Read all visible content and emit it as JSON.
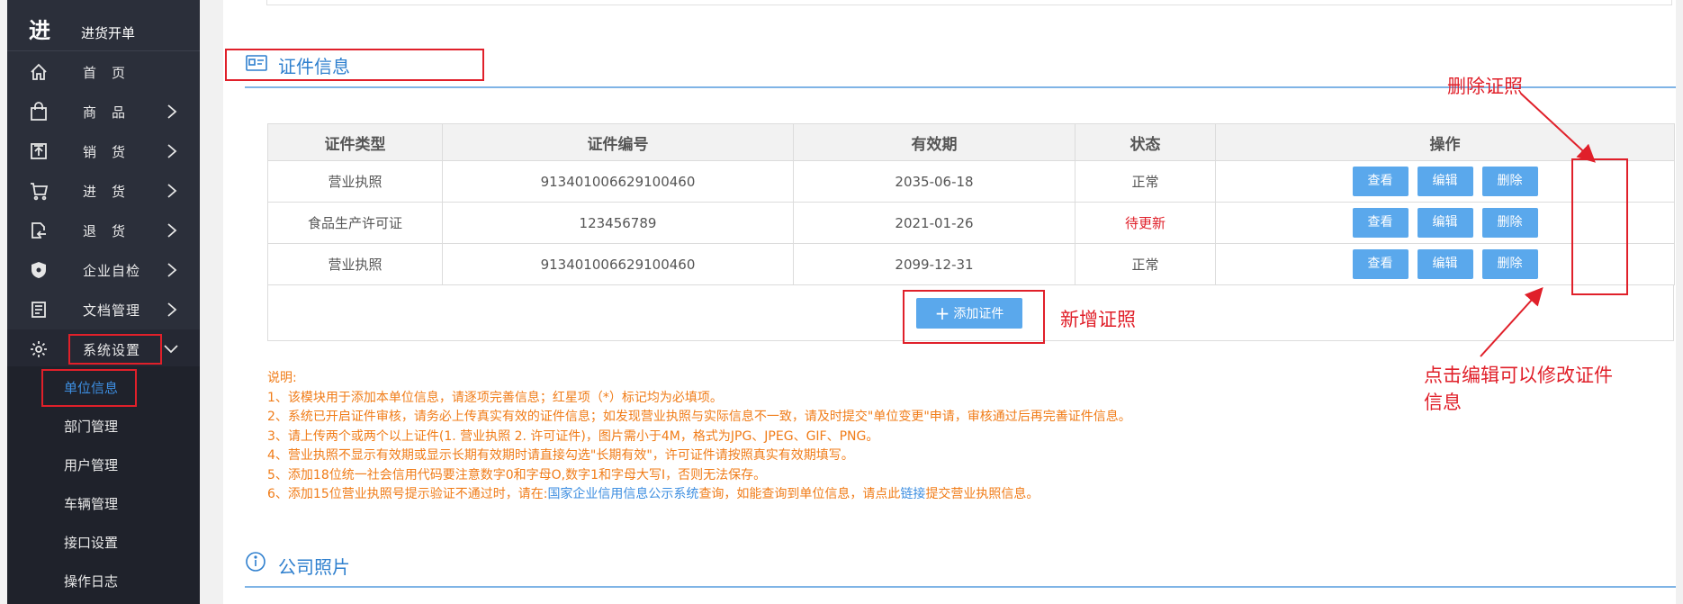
{
  "sidebar": {
    "brand_char": "进",
    "brand_text": "进货开单",
    "items": [
      {
        "label": "首　页",
        "icon": "home-icon"
      },
      {
        "label": "商　品",
        "icon": "bag-icon"
      },
      {
        "label": "销　货",
        "icon": "upload-box-icon"
      },
      {
        "label": "进　货",
        "icon": "cart-icon"
      },
      {
        "label": "退　货",
        "icon": "return-doc-icon"
      },
      {
        "label": "企业自检",
        "icon": "shield-icon"
      },
      {
        "label": "文档管理",
        "icon": "document-icon"
      },
      {
        "label": "系统设置",
        "icon": "gear-icon"
      }
    ],
    "subitems": [
      {
        "label": "单位信息"
      },
      {
        "label": "部门管理"
      },
      {
        "label": "用户管理"
      },
      {
        "label": "车辆管理"
      },
      {
        "label": "接口设置"
      },
      {
        "label": "操作日志"
      }
    ]
  },
  "cert_section": {
    "title": "证件信息",
    "headers": [
      "证件类型",
      "证件编号",
      "有效期",
      "状态",
      "操作"
    ],
    "rows": [
      {
        "type": "营业执照",
        "number": "913401006629100460",
        "expiry": "2035-06-18",
        "status": "正常"
      },
      {
        "type": "食品生产许可证",
        "number": "123456789",
        "expiry": "2021-01-26",
        "status": "待更新"
      },
      {
        "type": "营业执照",
        "number": "913401006629100460",
        "expiry": "2099-12-31",
        "status": "正常"
      }
    ],
    "actions": {
      "view": "查看",
      "edit": "编辑",
      "delete": "删除"
    },
    "add_button": "添加证件",
    "add_icon": "plus-icon"
  },
  "annotations": {
    "delete": "删除证照",
    "add": "新增证照",
    "edit_line1": "点击编辑可以修改证件",
    "edit_line2": "信息"
  },
  "notes": {
    "heading": "说明:",
    "l1": "1、该模块用于添加本单位信息，请逐项完善信息；红星项（*）标记均为必填项。",
    "l2": "2、系统已开启证件审核，请务必上传真实有效的证件信息；如发现营业执照与实际信息不一致，请及时提交\"单位变更\"申请，审核通过后再完善证件信息。",
    "l3": "3、请上传两个或两个以上证件(1. 营业执照 2. 许可证件)，图片需小于4M，格式为JPG、JPEG、GIF、PNG。",
    "l4": "4、营业执照不显示有效期或显示长期有效期时请直接勾选\"长期有效\"，许可证件请按照真实有效期填写。",
    "l5": "5、添加18位统一社会信用代码要注意数字0和字母O,数字1和字母大写I，否则无法保存。",
    "l6_a": "6、添加15位营业执照号提示验证不通过时，请在:",
    "l6_link1": "国家企业信用信息公示系统",
    "l6_b": "查询，如能查询到单位信息，请点此",
    "l6_link2": "链接",
    "l6_c": "提交营业执照信息。"
  },
  "photo_section": {
    "title": "公司照片"
  },
  "colors": {
    "accent": "#2e7fce",
    "button": "#5aa8ec",
    "annotation": "#e0202a",
    "notes": "#f07c18",
    "sidebar": "#2b2f3a"
  }
}
